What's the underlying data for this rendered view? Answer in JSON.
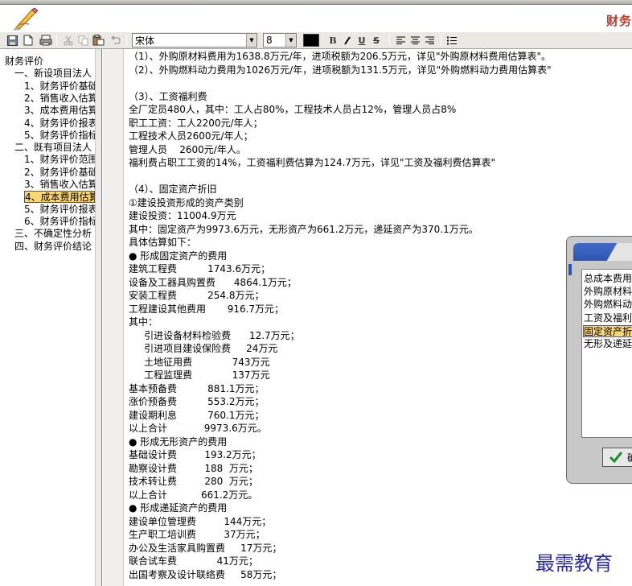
{
  "app": {
    "title": "财务"
  },
  "toolbar": {
    "font_name": "宋体",
    "font_size": "8",
    "text_color": "#000000",
    "icons": [
      "save-icon",
      "new-icon",
      "print-icon",
      "cut-icon",
      "copy-icon",
      "paste-icon",
      "undo-icon",
      "bold-icon",
      "italic-icon",
      "underline-icon",
      "strikethrough-icon",
      "align-left-icon",
      "align-center-icon",
      "align-right-icon",
      "bullets-icon"
    ]
  },
  "sidebar": {
    "items": [
      {
        "label": "财务评价",
        "level": 0
      },
      {
        "label": "一、新设项目法人",
        "level": 1
      },
      {
        "label": "1、财务评价基础",
        "level": 2
      },
      {
        "label": "2、销售收入估算",
        "level": 2
      },
      {
        "label": "3、成本费用估算",
        "level": 2
      },
      {
        "label": "4、财务评价报表",
        "level": 2
      },
      {
        "label": "5、财务评价指标",
        "level": 2
      },
      {
        "label": "二、既有项目法人",
        "level": 1
      },
      {
        "label": "1、财务评价范围",
        "level": 2
      },
      {
        "label": "2、财务评价基础",
        "level": 2
      },
      {
        "label": "3、销售收入估算",
        "level": 2
      },
      {
        "label": "4、成本费用估算",
        "level": 2,
        "selected": true
      },
      {
        "label": "5、财务评价报表",
        "level": 2
      },
      {
        "label": "6、财务评价指标",
        "level": 2
      },
      {
        "label": "三、不确定性分析",
        "level": 1
      },
      {
        "label": "四、财务评价结论",
        "level": 1
      }
    ]
  },
  "document": {
    "lines": [
      "（1）、外购原材料费用为1638.8万元/年，进项税额为206.5万元，详见\"外购原材料费用估算表\"。",
      "（2）、外购燃料动力费用为1026万元/年，进项税额为131.5万元，详见\"外购燃料动力费用估算表\"",
      "",
      "（3）、工资福利费",
      "全厂定员480人，其中：工人占80%，工程技术人员占12%，管理人员占8%",
      "职工工资：工人2200元/年人；",
      "工程技术人员2600元/年人；",
      "管理人员    2600元/年人。",
      "福利费占职工工资的14%，工资福利费估算为124.7万元，详见\"工资及福利费估算表\"",
      "",
      "（4）、固定资产折旧",
      "①建设投资形成的资产类别",
      "建设投资：11004.9万元",
      "其中：固定资产为9973.6万元，无形资产为661.2万元，递延资产为370.1万元。",
      "具体估算如下：",
      "● 形成固定资产的费用",
      "建筑工程费          1743.6万元；",
      "设备及工器具购置费      4864.1万元；",
      "安装工程费          254.8万元；",
      "工程建设其他费用       916.7万元；",
      "其中：",
      "     引进设备材料检验费      12.7万元；",
      "     引进项目建设保险费     24万元",
      "     土地征用费             743万元",
      "     工程监理费             137万元",
      "基本预备费          881.1万元；",
      "涨价预备费          553.2万元；",
      "建设期利息          760.1万元；",
      "以上合计            9973.6万元。",
      "● 形成无形资产的费用",
      "基础设计费         193.2万元；",
      "勘察设计费         188  万元；",
      "技术转让费         280  万元；",
      "以上合计           661.2万元。",
      "● 形成递延资产的费用",
      "建设单位管理费         144万元；",
      "生产职工培训费         37万元；",
      "办公及生活家具购置费     17万元；",
      "联合试车费             41万元；",
      "出国考察及设计联络费     58万元；"
    ]
  },
  "dialog": {
    "items": [
      {
        "label": "总成本费用"
      },
      {
        "label": "外购原材料"
      },
      {
        "label": "外购燃料动"
      },
      {
        "label": "工资及福利"
      },
      {
        "label": "固定资产折",
        "selected": true
      },
      {
        "label": "无形及递延"
      }
    ],
    "ok_icon": "checkmark-icon",
    "ok_label": "确"
  },
  "watermark": "最需教育"
}
